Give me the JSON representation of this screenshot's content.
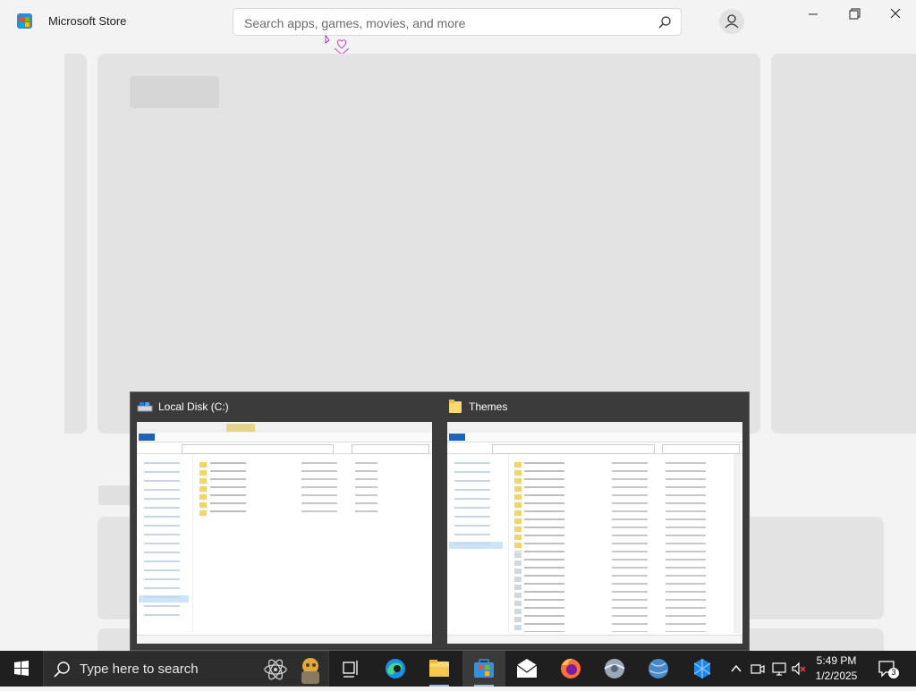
{
  "app": {
    "title": "Microsoft Store"
  },
  "search": {
    "placeholder": "Search apps, games, movies, and more"
  },
  "taskbar": {
    "search_placeholder": "Type here to search",
    "time": "5:49 PM",
    "date": "1/2/2025",
    "notification_count": "3"
  },
  "preview": {
    "windows": [
      {
        "title": "Local Disk (C:)",
        "icon": "drive-icon"
      },
      {
        "title": "Themes",
        "icon": "folder-icon"
      }
    ]
  },
  "colors": {
    "accent": "#0067c0",
    "taskbar": "#1f1f1f",
    "preview_bg": "#3b3b3b"
  }
}
